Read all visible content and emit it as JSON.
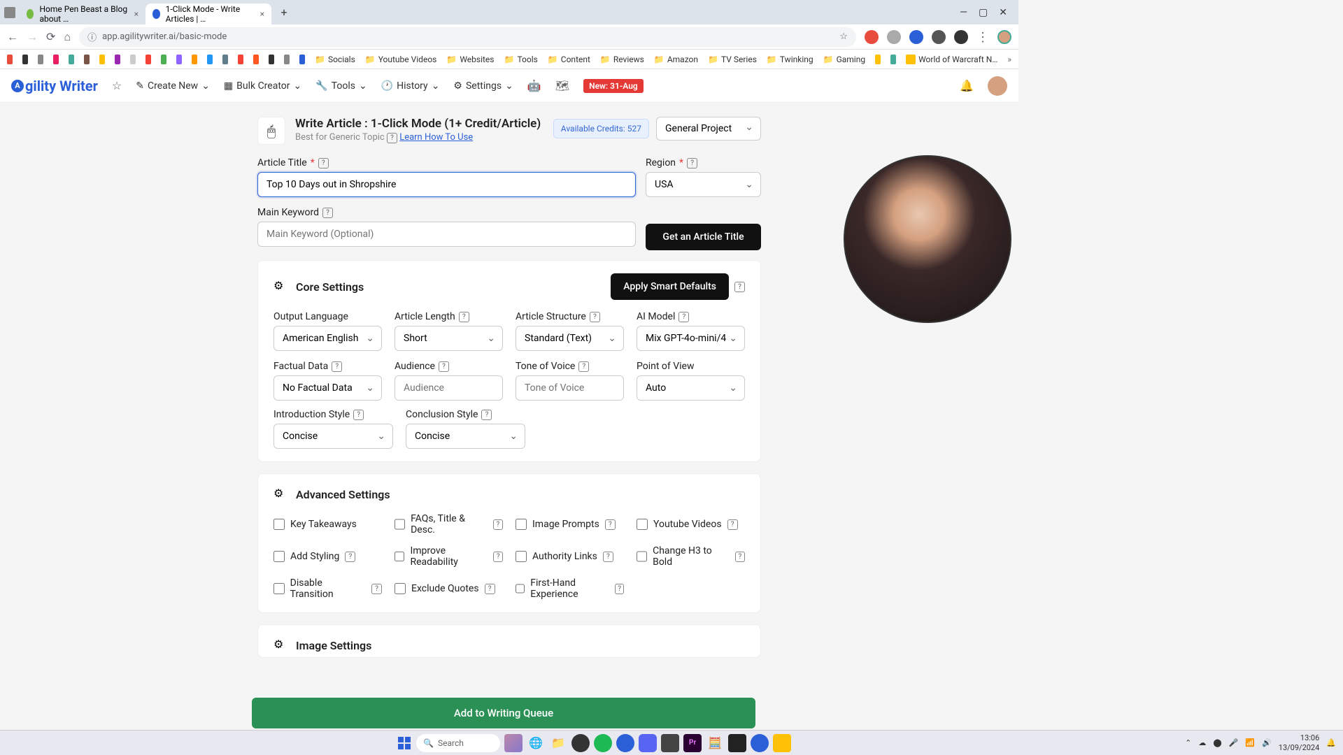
{
  "browser": {
    "tabs": [
      {
        "title": "Home Pen Beast a Blog about …",
        "active": false
      },
      {
        "title": "1-Click Mode - Write Articles | …",
        "active": true
      }
    ],
    "url": "app.agilitywriter.ai/basic-mode"
  },
  "bookmarks": {
    "items": [
      "Socials",
      "Youtube Videos",
      "Websites",
      "Tools",
      "Content",
      "Reviews",
      "Amazon",
      "TV Series",
      "Twinking",
      "Gaming"
    ],
    "trailing": "World of Warcraft N…"
  },
  "appnav": {
    "logo": "gility Writer",
    "create": "Create New",
    "bulk": "Bulk Creator",
    "tools": "Tools",
    "history": "History",
    "settings": "Settings",
    "badge": "New: 31-Aug"
  },
  "page": {
    "title": "Write Article : 1-Click Mode (1+ Credit/Article)",
    "subtitle": "Best for Generic Topic",
    "learn": "Learn How To Use",
    "credits": "Available Credits: 527",
    "project": "General Project"
  },
  "form": {
    "article_title_label": "Article Title",
    "article_title_value": "Top 10 Days out in Shropshire",
    "region_label": "Region",
    "region_value": "USA",
    "keyword_label": "Main Keyword",
    "keyword_placeholder": "Main Keyword (Optional)",
    "get_title_btn": "Get an Article Title"
  },
  "core": {
    "heading": "Core Settings",
    "apply_defaults": "Apply Smart Defaults",
    "output_lang_label": "Output Language",
    "output_lang_value": "American English",
    "length_label": "Article Length",
    "length_value": "Short",
    "structure_label": "Article Structure",
    "structure_value": "Standard (Text)",
    "model_label": "AI Model",
    "model_value": "Mix GPT-4o-mini/4",
    "factual_label": "Factual Data",
    "factual_value": "No Factual Data",
    "audience_label": "Audience",
    "audience_placeholder": "Audience",
    "tone_label": "Tone of Voice",
    "tone_placeholder": "Tone of Voice",
    "pov_label": "Point of View",
    "pov_value": "Auto",
    "intro_label": "Introduction Style",
    "intro_value": "Concise",
    "concl_label": "Conclusion Style",
    "concl_value": "Concise"
  },
  "advanced": {
    "heading": "Advanced Settings",
    "opts": {
      "takeaways": "Key Takeaways",
      "faqs": "FAQs, Title & Desc.",
      "prompts": "Image Prompts",
      "youtube": "Youtube Videos",
      "styling": "Add Styling",
      "readability": "Improve Readability",
      "authority": "Authority Links",
      "h3bold": "Change H3 to Bold",
      "transition": "Disable Transition",
      "quotes": "Exclude Quotes",
      "firsthand": "First-Hand Experience"
    }
  },
  "image_settings": {
    "heading": "Image Settings"
  },
  "queue_btn": "Add to Writing Queue",
  "taskbar": {
    "search": "Search",
    "time": "13:06",
    "date": "13/09/2024"
  }
}
